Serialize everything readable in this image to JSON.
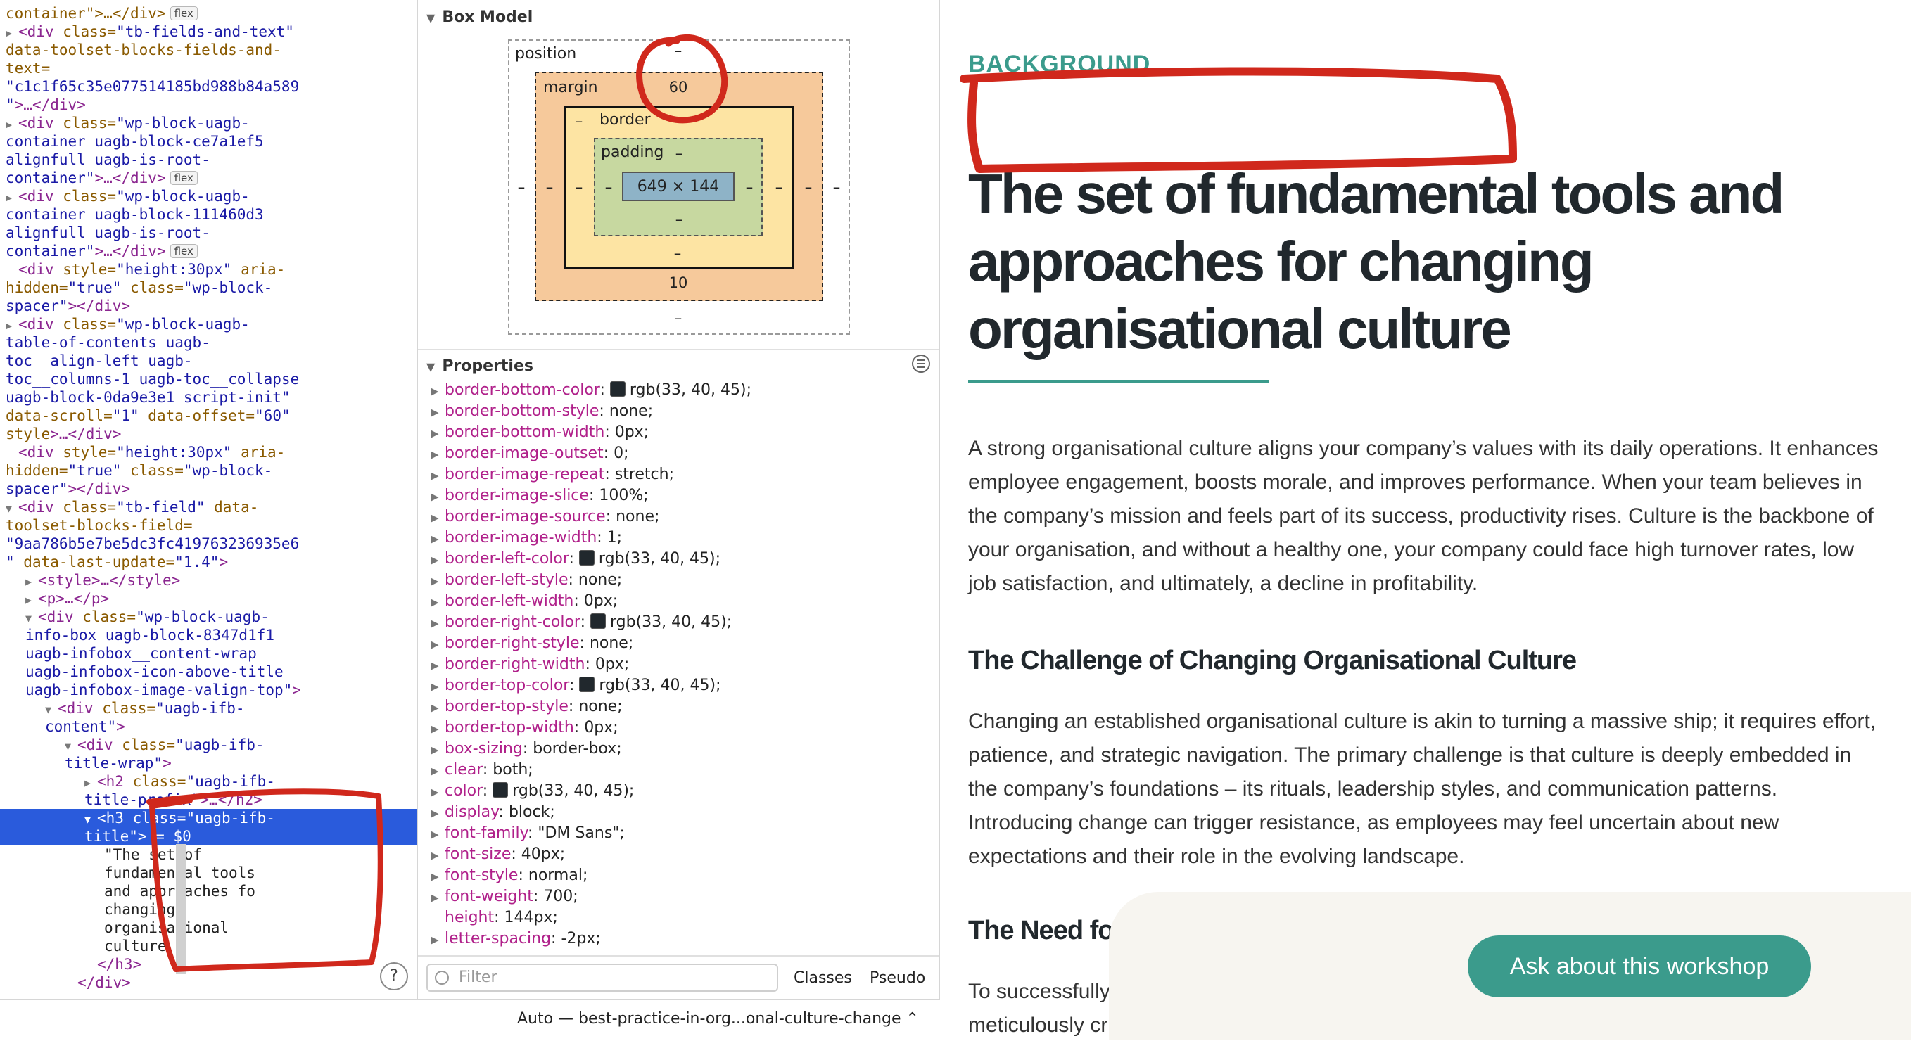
{
  "dom_tree": {
    "lines": [
      {
        "indent": 8,
        "tri": "",
        "parts": [
          [
            "attr",
            "container\">…</div>"
          ]
        ],
        "badge": "flex"
      },
      {
        "indent": 8,
        "tri": "▶",
        "parts": [
          [
            "tag",
            "<div "
          ],
          [
            "attr",
            "class="
          ],
          [
            "val",
            "\"tb-fields-and-text\""
          ]
        ],
        "badge": ""
      },
      {
        "indent": 8,
        "tri": "",
        "parts": [
          [
            "attr",
            "data-toolset-blocks-fields-and-"
          ]
        ],
        "badge": ""
      },
      {
        "indent": 8,
        "tri": "",
        "parts": [
          [
            "attr",
            "text="
          ]
        ],
        "badge": ""
      },
      {
        "indent": 8,
        "tri": "",
        "parts": [
          [
            "val",
            "\"c1c1f65c35e077514185bd988b84a589"
          ]
        ],
        "badge": ""
      },
      {
        "indent": 8,
        "tri": "",
        "parts": [
          [
            "val",
            "\""
          ],
          [
            "tag",
            ">…</div>"
          ]
        ],
        "badge": ""
      },
      {
        "indent": 8,
        "tri": "▶",
        "parts": [
          [
            "tag",
            "<div "
          ],
          [
            "attr",
            "class="
          ],
          [
            "val",
            "\"wp-block-uagb-"
          ]
        ],
        "badge": ""
      },
      {
        "indent": 8,
        "tri": "",
        "parts": [
          [
            "val",
            "container uagb-block-ce7a1ef5"
          ]
        ],
        "badge": ""
      },
      {
        "indent": 8,
        "tri": "",
        "parts": [
          [
            "val",
            "alignfull uagb-is-root-"
          ]
        ],
        "badge": ""
      },
      {
        "indent": 8,
        "tri": "",
        "parts": [
          [
            "val",
            "container\""
          ],
          [
            "tag",
            ">…</div>"
          ]
        ],
        "badge": "flex"
      },
      {
        "indent": 8,
        "tri": "▶",
        "parts": [
          [
            "tag",
            "<div "
          ],
          [
            "attr",
            "class="
          ],
          [
            "val",
            "\"wp-block-uagb-"
          ]
        ],
        "badge": ""
      },
      {
        "indent": 8,
        "tri": "",
        "parts": [
          [
            "val",
            "container uagb-block-111460d3"
          ]
        ],
        "badge": ""
      },
      {
        "indent": 8,
        "tri": "",
        "parts": [
          [
            "val",
            "alignfull uagb-is-root-"
          ]
        ],
        "badge": ""
      },
      {
        "indent": 8,
        "tri": "",
        "parts": [
          [
            "val",
            "container\""
          ],
          [
            "tag",
            ">…</div>"
          ]
        ],
        "badge": "flex"
      },
      {
        "indent": 8,
        "tri": "  ",
        "parts": [
          [
            "tag",
            "<div "
          ],
          [
            "attr",
            "style="
          ],
          [
            "val",
            "\"height:30px\""
          ],
          [
            "attr",
            " aria-"
          ]
        ],
        "badge": ""
      },
      {
        "indent": 8,
        "tri": "",
        "parts": [
          [
            "attr",
            "hidden="
          ],
          [
            "val",
            "\"true\""
          ],
          [
            "attr",
            " class="
          ],
          [
            "val",
            "\"wp-block-"
          ]
        ],
        "badge": ""
      },
      {
        "indent": 8,
        "tri": "",
        "parts": [
          [
            "val",
            "spacer\""
          ],
          [
            "tag",
            "></div>"
          ]
        ],
        "badge": ""
      },
      {
        "indent": 8,
        "tri": "▶",
        "parts": [
          [
            "tag",
            "<div "
          ],
          [
            "attr",
            "class="
          ],
          [
            "val",
            "\"wp-block-uagb-"
          ]
        ],
        "badge": ""
      },
      {
        "indent": 8,
        "tri": "",
        "parts": [
          [
            "val",
            "table-of-contents uagb-"
          ]
        ],
        "badge": ""
      },
      {
        "indent": 8,
        "tri": "",
        "parts": [
          [
            "val",
            "toc__align-left uagb-"
          ]
        ],
        "badge": ""
      },
      {
        "indent": 8,
        "tri": "",
        "parts": [
          [
            "val",
            "toc__columns-1 uagb-toc__collapse"
          ]
        ],
        "badge": ""
      },
      {
        "indent": 8,
        "tri": "",
        "parts": [
          [
            "val",
            "uagb-block-0da9e3e1 script-init\""
          ]
        ],
        "badge": ""
      },
      {
        "indent": 8,
        "tri": "",
        "parts": [
          [
            "attr",
            "data-scroll="
          ],
          [
            "val",
            "\"1\""
          ],
          [
            "attr",
            " data-offset="
          ],
          [
            "val",
            "\"60\""
          ]
        ],
        "badge": ""
      },
      {
        "indent": 8,
        "tri": "",
        "parts": [
          [
            "attr",
            "style"
          ],
          [
            "tag",
            ">…</div>"
          ]
        ],
        "badge": ""
      },
      {
        "indent": 8,
        "tri": "  ",
        "parts": [
          [
            "tag",
            "<div "
          ],
          [
            "attr",
            "style="
          ],
          [
            "val",
            "\"height:30px\""
          ],
          [
            "attr",
            " aria-"
          ]
        ],
        "badge": ""
      },
      {
        "indent": 8,
        "tri": "",
        "parts": [
          [
            "attr",
            "hidden="
          ],
          [
            "val",
            "\"true\""
          ],
          [
            "attr",
            " class="
          ],
          [
            "val",
            "\"wp-block-"
          ]
        ],
        "badge": ""
      },
      {
        "indent": 8,
        "tri": "",
        "parts": [
          [
            "val",
            "spacer\""
          ],
          [
            "tag",
            "></div>"
          ]
        ],
        "badge": ""
      },
      {
        "indent": 8,
        "tri": "▼",
        "parts": [
          [
            "tag",
            "<div "
          ],
          [
            "attr",
            "class="
          ],
          [
            "val",
            "\"tb-field\""
          ],
          [
            "attr",
            " data-"
          ]
        ],
        "badge": ""
      },
      {
        "indent": 8,
        "tri": "",
        "parts": [
          [
            "attr",
            "toolset-blocks-field="
          ]
        ],
        "badge": ""
      },
      {
        "indent": 8,
        "tri": "",
        "parts": [
          [
            "val",
            "\"9aa786b5e7be5dc3fc419763236935e6"
          ]
        ],
        "badge": ""
      },
      {
        "indent": 8,
        "tri": "",
        "parts": [
          [
            "val",
            "\""
          ],
          [
            "attr",
            " data-last-update="
          ],
          [
            "val",
            "\"1.4\""
          ],
          [
            "tag",
            ">"
          ]
        ],
        "badge": ""
      },
      {
        "indent": 36,
        "tri": "▶",
        "parts": [
          [
            "tag",
            "<style>…</style>"
          ]
        ],
        "badge": ""
      },
      {
        "indent": 36,
        "tri": "▶",
        "parts": [
          [
            "tag",
            "<p>…</p>"
          ]
        ],
        "badge": ""
      },
      {
        "indent": 36,
        "tri": "▼",
        "parts": [
          [
            "tag",
            "<div "
          ],
          [
            "attr",
            "class="
          ],
          [
            "val",
            "\"wp-block-uagb-"
          ]
        ],
        "badge": ""
      },
      {
        "indent": 36,
        "tri": "",
        "parts": [
          [
            "val",
            "info-box uagb-block-8347d1f1"
          ]
        ],
        "badge": ""
      },
      {
        "indent": 36,
        "tri": "",
        "parts": [
          [
            "val",
            "uagb-infobox__content-wrap"
          ]
        ],
        "badge": ""
      },
      {
        "indent": 36,
        "tri": "",
        "parts": [
          [
            "val",
            "uagb-infobox-icon-above-title"
          ]
        ],
        "badge": ""
      },
      {
        "indent": 36,
        "tri": "",
        "parts": [
          [
            "val",
            "uagb-infobox-image-valign-top\""
          ],
          [
            "tag",
            ">"
          ]
        ],
        "badge": ""
      },
      {
        "indent": 64,
        "tri": "▼",
        "parts": [
          [
            "tag",
            "<div "
          ],
          [
            "attr",
            "class="
          ],
          [
            "val",
            "\"uagb-ifb-"
          ]
        ],
        "badge": ""
      },
      {
        "indent": 64,
        "tri": "",
        "parts": [
          [
            "val",
            "content\""
          ],
          [
            "tag",
            ">"
          ]
        ],
        "badge": ""
      },
      {
        "indent": 92,
        "tri": "▼",
        "parts": [
          [
            "tag",
            "<div "
          ],
          [
            "attr",
            "class="
          ],
          [
            "val",
            "\"uagb-ifb-"
          ]
        ],
        "badge": ""
      },
      {
        "indent": 92,
        "tri": "",
        "parts": [
          [
            "val",
            "title-wrap\""
          ],
          [
            "tag",
            ">"
          ]
        ],
        "badge": ""
      },
      {
        "indent": 120,
        "tri": "▶",
        "parts": [
          [
            "tag",
            "<h2 "
          ],
          [
            "attr",
            "class="
          ],
          [
            "val",
            "\"uagb-ifb-"
          ]
        ],
        "badge": ""
      },
      {
        "indent": 120,
        "tri": "",
        "parts": [
          [
            "val",
            "title-prefix\""
          ],
          [
            "tag",
            ">…</h2>"
          ]
        ],
        "badge": ""
      },
      {
        "indent": 120,
        "tri": "▼",
        "parts": [
          [
            "tag",
            "<h3 "
          ],
          [
            "attr",
            "class="
          ],
          [
            "val",
            "\"uagb-ifb-"
          ]
        ],
        "badge": "",
        "selected": true
      },
      {
        "indent": 120,
        "tri": "",
        "parts": [
          [
            "val",
            "title\""
          ],
          [
            "tag",
            "> "
          ],
          [
            "dtext",
            "= $0"
          ]
        ],
        "badge": "",
        "selected": true
      },
      {
        "indent": 148,
        "tri": "",
        "parts": [
          [
            "dtext",
            "\"The set of"
          ]
        ],
        "badge": ""
      },
      {
        "indent": 148,
        "tri": "",
        "parts": [
          [
            "dtext",
            "fundamental tools"
          ]
        ],
        "badge": ""
      },
      {
        "indent": 148,
        "tri": "",
        "parts": [
          [
            "dtext",
            "and approaches fo"
          ]
        ],
        "badge": ""
      },
      {
        "indent": 148,
        "tri": "",
        "parts": [
          [
            "dtext",
            "changing"
          ]
        ],
        "badge": ""
      },
      {
        "indent": 148,
        "tri": "",
        "parts": [
          [
            "dtext",
            "organisational"
          ]
        ],
        "badge": ""
      },
      {
        "indent": 148,
        "tri": "",
        "parts": [
          [
            "dtext",
            "culture \""
          ]
        ],
        "badge": ""
      },
      {
        "indent": 138,
        "tri": "",
        "parts": [
          [
            "tag",
            "</h3>"
          ]
        ],
        "badge": ""
      },
      {
        "indent": 110,
        "tri": "",
        "parts": [
          [
            "tag",
            "</div>"
          ]
        ],
        "badge": ""
      }
    ],
    "help_label": "?"
  },
  "styles": {
    "box_model": {
      "heading": "Box Model",
      "position_label": "position",
      "position_top": "–",
      "position_bottom": "–",
      "position_left": "–",
      "position_right": "–",
      "margin_label": "margin",
      "margin_top": "60",
      "margin_bottom": "10",
      "margin_left": "–",
      "margin_right": "–",
      "border_label": "border",
      "border_top": "–",
      "border_bottom": "–",
      "border_left": "–",
      "border_right": "–",
      "padding_label": "padding",
      "padding_top": "–",
      "padding_bottom": "–",
      "padding_left": "–",
      "padding_right": "–",
      "content_size": "649 × 144"
    },
    "properties": {
      "heading": "Properties",
      "rows": [
        {
          "name": "border-bottom-color",
          "value": "rgb(33, 40, 45)",
          "swatch": true
        },
        {
          "name": "border-bottom-style",
          "value": "none",
          "swatch": false
        },
        {
          "name": "border-bottom-width",
          "value": "0px",
          "swatch": false
        },
        {
          "name": "border-image-outset",
          "value": "0",
          "swatch": false
        },
        {
          "name": "border-image-repeat",
          "value": "stretch",
          "swatch": false
        },
        {
          "name": "border-image-slice",
          "value": "100%",
          "swatch": false
        },
        {
          "name": "border-image-source",
          "value": "none",
          "swatch": false
        },
        {
          "name": "border-image-width",
          "value": "1",
          "swatch": false
        },
        {
          "name": "border-left-color",
          "value": "rgb(33, 40, 45)",
          "swatch": true
        },
        {
          "name": "border-left-style",
          "value": "none",
          "swatch": false
        },
        {
          "name": "border-left-width",
          "value": "0px",
          "swatch": false
        },
        {
          "name": "border-right-color",
          "value": "rgb(33, 40, 45)",
          "swatch": true
        },
        {
          "name": "border-right-style",
          "value": "none",
          "swatch": false
        },
        {
          "name": "border-right-width",
          "value": "0px",
          "swatch": false
        },
        {
          "name": "border-top-color",
          "value": "rgb(33, 40, 45)",
          "swatch": true
        },
        {
          "name": "border-top-style",
          "value": "none",
          "swatch": false
        },
        {
          "name": "border-top-width",
          "value": "0px",
          "swatch": false
        },
        {
          "name": "box-sizing",
          "value": "border-box",
          "swatch": false
        },
        {
          "name": "clear",
          "value": "both",
          "swatch": false
        },
        {
          "name": "color",
          "value": "rgb(33, 40, 45)",
          "swatch": true
        },
        {
          "name": "display",
          "value": "block",
          "swatch": false
        },
        {
          "name": "font-family",
          "value": "\"DM Sans\"",
          "swatch": false
        },
        {
          "name": "font-size",
          "value": "40px",
          "swatch": false
        },
        {
          "name": "font-style",
          "value": "normal",
          "swatch": false
        },
        {
          "name": "font-weight",
          "value": "700",
          "swatch": false
        },
        {
          "name": "height",
          "value": "144px",
          "swatch": false,
          "notri": true
        },
        {
          "name": "letter-spacing",
          "value": "-2px",
          "swatch": false
        }
      ]
    },
    "filter_placeholder": "Filter",
    "classes_label": "Classes",
    "pseudo_label": "Pseudo"
  },
  "status_bar": {
    "text": "Auto — best-practice-in-org...onal-culture-change ⌃"
  },
  "page": {
    "eyebrow": "BACKGROUND",
    "headline_lines": [
      "The set of fundamental tools and",
      "approaches for changing",
      "organisational culture"
    ],
    "intro": "A strong organisational culture aligns your company’s values with its daily operations. It enhances employee engagement, boosts morale, and improves performance. When your team believes in the company’s mission and feels part of its success, productivity rises. Culture is the backbone of your organisation, and without a healthy one, your company could face high turnover rates, low job satisfaction, and ultimately, a decline in profitability.",
    "challenge_heading": "The Challenge of Changing Organisational Culture",
    "challenge_text": "Changing an established organisational culture is akin to turning a massive ship; it requires effort, patience, and strategic navigation. The primary challenge is that culture is deeply embedded in the company’s foundations – its rituals, leadership styles, and communication patterns. Introducing change can trigger resistance, as employees may feel uncertain about new expectations and their role in the evolving landscape.",
    "need_heading": "The Need fo",
    "need_text_1": "To successfully",
    "need_text_2": "meticulously cr",
    "cta_label": "Ask about this workshop",
    "accent_color": "#3b9b8c"
  },
  "annotation_color": "#d0281c"
}
